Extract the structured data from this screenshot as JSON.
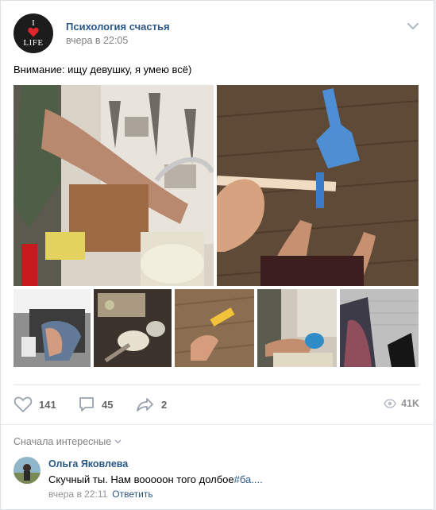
{
  "post": {
    "group_name": "Психология счастья",
    "time": "вчера в 22:05",
    "text": "Внимание: ищу девушку, я умею всё)",
    "logo_top": "I",
    "logo_bottom": "LIFE"
  },
  "actions": {
    "likes": "141",
    "comments": "45",
    "shares": "2",
    "views": "41K"
  },
  "comments_section": {
    "sort_label": "Сначала интересные",
    "items": [
      {
        "author": "Ольга Яковлева",
        "text": "Скучный ты. Нам вооооон того долбое",
        "hashtag": "#ба....",
        "time": "вчера в 22:11",
        "reply_label": "Ответить"
      }
    ]
  },
  "icons": {
    "like": "heart-icon",
    "comment": "comment-icon",
    "share": "share-icon",
    "views": "eye-icon",
    "more": "chevron-down-icon"
  },
  "colors": {
    "link": "#2a5885",
    "muted": "#828282",
    "logo_heart": "#e0262c"
  }
}
